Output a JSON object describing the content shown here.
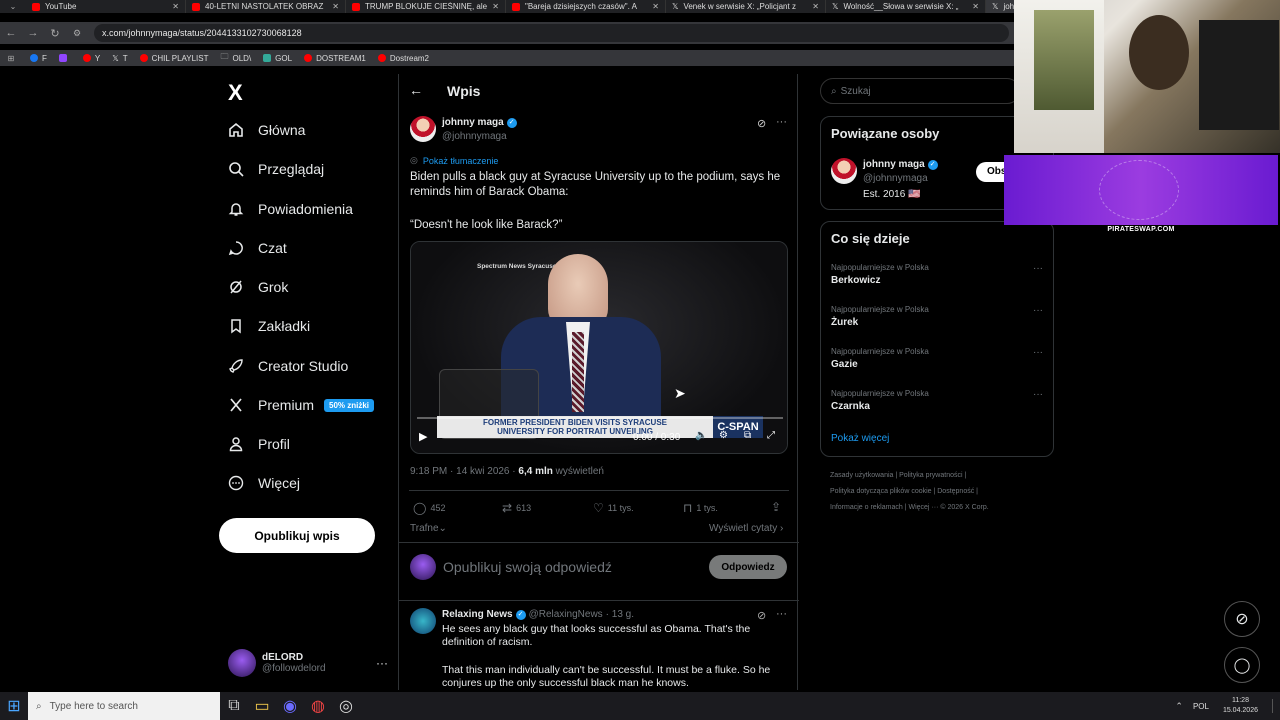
{
  "browser": {
    "tabs": [
      {
        "title": "YouTube",
        "color": "#ff0000"
      },
      {
        "title": "40-LETNI NASTOLATEK OBRAZ",
        "color": "#ff0000"
      },
      {
        "title": "TRUMP BLOKUJE CIEŚNINĘ, ale",
        "color": "#ff0000"
      },
      {
        "title": "\"Bareja dzisiejszych czasów\". A",
        "color": "#ff0000"
      },
      {
        "title": "Venek w serwisie X: „Policjant z",
        "color": "#ffffff"
      },
      {
        "title": "Wolność__Słowa w serwisie X: „",
        "color": "#ffffff"
      },
      {
        "title": "joh",
        "color": "#ffffff"
      }
    ],
    "url": "x.com/johnnymaga/status/2044133102730068128",
    "bookmarks": [
      "F",
      "",
      "Y",
      "T",
      "CHIL PLAYLIST",
      "OLD\\",
      "GOL",
      "DOSTREAM1",
      "Dostream2"
    ]
  },
  "sidebar": {
    "logo": "X",
    "items": [
      {
        "label": "Główna",
        "icon": "home-icon"
      },
      {
        "label": "Przeglądaj",
        "icon": "search-icon"
      },
      {
        "label": "Powiadomienia",
        "icon": "bell-icon"
      },
      {
        "label": "Czat",
        "icon": "chat-icon"
      },
      {
        "label": "Grok",
        "icon": "grok-icon"
      },
      {
        "label": "Zakładki",
        "icon": "bookmark-icon"
      },
      {
        "label": "Creator Studio",
        "icon": "rocket-icon"
      },
      {
        "label": "Premium",
        "icon": "x-icon"
      },
      {
        "label": "Profil",
        "icon": "person-icon"
      },
      {
        "label": "Więcej",
        "icon": "more-circle-icon"
      }
    ],
    "premium_badge": "50% zniżki",
    "publish_label": "Opublikuj wpis",
    "account": {
      "name": "dELORD",
      "handle": "@followdelord"
    }
  },
  "post": {
    "header_title": "Wpis",
    "author_name": "johnny maga",
    "author_handle": "@johnnymaga",
    "translate": "Pokaż tłumaczenie",
    "text_1": "Biden pulls a black guy at Syracuse University up to the podium, says he reminds him of Barack Obama:",
    "text_2": "“Doesn't he look like Barack?”",
    "video": {
      "watermark": "Spectrum News Syracuse",
      "lower_third_1": "FORMER PRESIDENT BIDEN VISITS SYRACUSE",
      "lower_third_2": "UNIVERSITY FOR PORTRAIT UNVEILING",
      "network": "C-SPAN",
      "time": "0:00 / 0:30"
    },
    "time": "9:18 PM · 14 kwi 2026 ·",
    "views": "6,4 mln",
    "views_label": "wyświetleń",
    "stats": {
      "replies": "452",
      "reposts": "613",
      "likes": "11 tys.",
      "bookmarks": "1 tys."
    },
    "sort_label": "Trafne",
    "quotes_label": "Wyświetl cytaty",
    "reply_placeholder": "Opublikuj swoją odpowiedź",
    "reply_button": "Odpowiedz"
  },
  "reply": {
    "name": "Relaxing News",
    "handle": "@RelaxingNews",
    "time": "· 13 g.",
    "text_1": "He sees any black guy that looks successful as Obama. That's the definition of racism.",
    "text_2": "That this man individually can't be successful. It must be a fluke. So he conjures up the only successful black man he knows."
  },
  "right": {
    "search_placeholder": "Szukaj",
    "related_title": "Powiązane osoby",
    "related_name": "johnny maga",
    "related_handle": "@johnnymaga",
    "related_bio": "Est. 2016 🇺🇸",
    "follow_label": "Obs",
    "trends_title": "Co się dzieje",
    "trends": [
      {
        "category": "Najpopularniejsze w Polska",
        "name": "Berkowicz"
      },
      {
        "category": "Najpopularniejsze w Polska",
        "name": "Żurek"
      },
      {
        "category": "Najpopularniejsze w Polska",
        "name": "Gazie"
      },
      {
        "category": "Najpopularniejsze w Polska",
        "name": "Czarnka"
      }
    ],
    "show_more": "Pokaż więcej",
    "footer": {
      "line1": "Zasady użytkowania  |  Polityka prywatności  |",
      "line2": "Polityka dotycząca plików cookie  |  Dostępność  |",
      "line3": "Informacje o reklamach  |  Więcej ···  © 2026 X Corp."
    }
  },
  "overlay": {
    "promo_label": "PIRATESWAP.COM"
  },
  "taskbar": {
    "search_placeholder": "Type here to search",
    "lang": "POL",
    "time": "11:28",
    "date": "15.04.2026"
  },
  "colors": {
    "accent": "#1d9bf0",
    "bg": "#000000",
    "border": "#2f3336",
    "muted": "#71767b"
  }
}
